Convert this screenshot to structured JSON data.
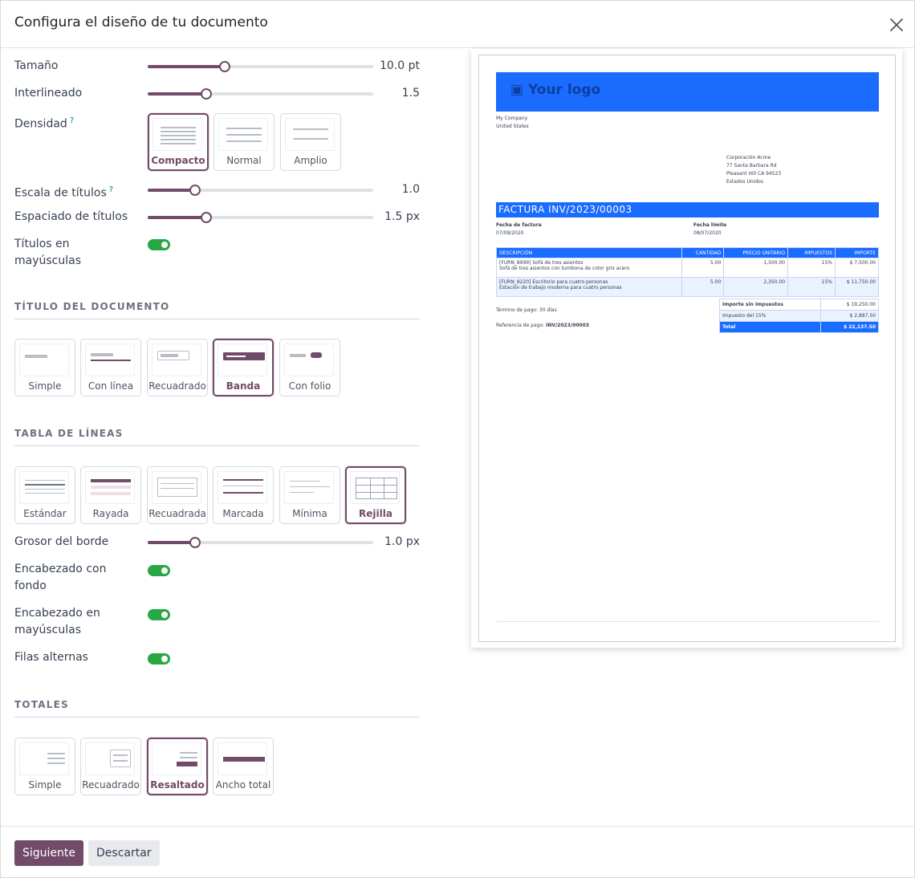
{
  "dialog": {
    "title": "Configura el diseño de tu documento"
  },
  "typography": {
    "size": {
      "label": "Tamaño",
      "value": "10.0 pt",
      "fraction": 0.34
    },
    "line_height": {
      "label": "Interlineado",
      "value": "1.5",
      "fraction": 0.26
    },
    "density": {
      "label": "Densidad",
      "help": "?",
      "options": [
        "Compacto",
        "Normal",
        "Amplio"
      ],
      "selected": "Compacto"
    },
    "title_scale": {
      "label": "Escala de títulos",
      "help": "?",
      "value": "1.0",
      "fraction": 0.21
    },
    "title_spacing": {
      "label": "Espaciado de títulos",
      "value": "1.5 px",
      "fraction": 0.26
    },
    "uppercase_titles": {
      "label_1": "Títulos en",
      "label_2": "mayúsculas",
      "on": true
    }
  },
  "document_title": {
    "heading": "TÍTULO DEL DOCUMENTO",
    "options": [
      "Simple",
      "Con línea",
      "Recuadrado",
      "Banda",
      "Con folio"
    ],
    "selected": "Banda"
  },
  "line_table": {
    "heading": "TABLA DE LÍNEAS",
    "options": [
      "Estándar",
      "Rayada",
      "Recuadrada",
      "Marcada",
      "Mínima",
      "Rejilla"
    ],
    "selected": "Rejilla",
    "border_width": {
      "label": "Grosor del borde",
      "value": "1.0 px",
      "fraction": 0.21
    },
    "header_background": {
      "label_1": "Encabezado con",
      "label_2": "fondo",
      "on": true
    },
    "header_uppercase": {
      "label_1": "Encabezado en",
      "label_2": "mayúsculas",
      "on": true
    },
    "alternate_rows": {
      "label": "Filas alternas",
      "on": true
    }
  },
  "totals": {
    "heading": "TOTALES",
    "options": [
      "Simple",
      "Recuadrado",
      "Resaltado",
      "Ancho total"
    ],
    "selected": "Resaltado"
  },
  "footer": {
    "next": "Siguiente",
    "discard": "Descartar"
  },
  "preview": {
    "logo": "Your logo",
    "company": [
      "My Company",
      "United States"
    ],
    "customer": [
      "Corporación Acme",
      "77 Santa Barbara Rd",
      "Pleasant Hill CA 94523",
      "Estados Unidos"
    ],
    "invoice_title": "FACTURA INV/2023/00003",
    "invoice_date_label": "Fecha de factura",
    "invoice_date": "07/08/2020",
    "due_date_label": "Fecha límite",
    "due_date": "08/07/2020",
    "columns": [
      "DESCRIPCIÓN",
      "CANTIDAD",
      "PRECIO UNITARIO",
      "IMPUESTOS",
      "IMPORTE"
    ],
    "rows": [
      {
        "desc_1": "[FURN_8999] Sofá de tres asientos",
        "desc_2": "Sofá de tres asientos con tumbona de color gris acero",
        "qty": "5.00",
        "price": "1,500.00",
        "tax": "15%",
        "amount": "$ 7,500.00"
      },
      {
        "desc_1": "[FURN_8220] Escritorio para cuatro personas",
        "desc_2": "Estación de trabajo moderna para cuatro personas",
        "qty": "5.00",
        "price": "2,350.00",
        "tax": "15%",
        "amount": "$ 11,750.00"
      }
    ],
    "payment_term": "Término de pago: 30 días",
    "payment_ref_label": "Referencia de pago:",
    "payment_ref": "INV/2023/00003",
    "totals": [
      {
        "label": "Importe sin impuestos",
        "value": "$ 19,250.00"
      },
      {
        "label": "Impuesto del 15%",
        "value": "$ 2,887.50"
      },
      {
        "label": "Total",
        "value": "$ 22,137.50"
      }
    ]
  },
  "colors": {
    "accent": "#714b67",
    "toggle_on": "#28a745",
    "preview_brand": "#1a6cff"
  }
}
